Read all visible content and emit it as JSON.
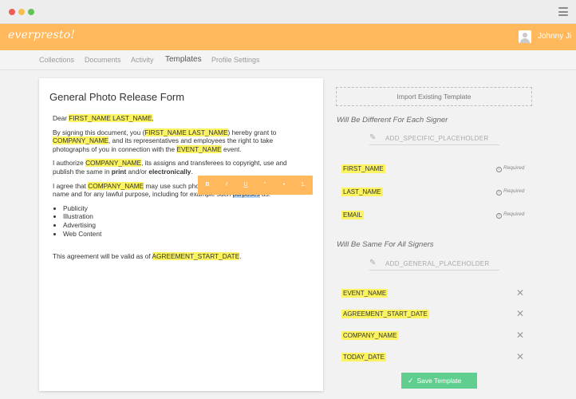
{
  "app": {
    "logo": "everpresto!",
    "user": {
      "name": "Johnny Ji"
    }
  },
  "nav": {
    "items": [
      "Collections",
      "Documents",
      "Activity",
      "Templates",
      "Profile Settings"
    ],
    "active": "Templates"
  },
  "document": {
    "title": "General Photo Release Form",
    "p1": {
      "pre": "Dear ",
      "hl": "FIRST_NAME LAST_NAME",
      "post": ","
    },
    "p2": {
      "a": "By signing this document, you (",
      "hl1": "FIRST_NAME LAST_NAME",
      "b": ") hereby grant to ",
      "hl2": "COMPANY_NAME",
      "c": ", and its representatives and employees the right to take photographs of you in connection with the ",
      "hl3": "EVENT_NAME",
      "d": " event."
    },
    "p3": {
      "a": "I authorize ",
      "hl1": "COMPANY_NAME",
      "b": ", its assigns and transferees to copyright, use and publish the same in ",
      "bold1": "print",
      "c": " and/or ",
      "bold2": "electronically",
      "d": "."
    },
    "p4": {
      "a": "I agree that ",
      "hl1": "COMPANY_NAME",
      "b": " may use such photographs of me with or without my name and for any lawful purpose, including for example such ",
      "sel": "purposes",
      "c": " as:"
    },
    "list": [
      "Publicity",
      "Illustration",
      "Advertising",
      "Web Content"
    ],
    "p5": {
      "a": "This agreement will be valid as of ",
      "hl": "AGREEMENT_START_DATE",
      "b": "."
    }
  },
  "format_toolbar": {
    "buttons": [
      "B",
      "I",
      "U",
      "\"",
      "•",
      "1."
    ]
  },
  "panel": {
    "import_label": "Import Existing Template",
    "different_heading": "Will Be Different For Each Signer",
    "specific_placeholder": "ADD_SPECIFIC_PLACEHOLDER",
    "signer_fields": [
      "FIRST_NAME",
      "LAST_NAME",
      "EMAIL"
    ],
    "required_label": "Required",
    "same_heading": "Will Be Same For All Signers",
    "general_placeholder": "ADD_GENERAL_PLACEHOLDER",
    "general_fields": [
      "EVENT_NAME",
      "AGREEMENT_START_DATE",
      "COMPANY_NAME",
      "TODAY_DATE"
    ],
    "save_label": "Save Template"
  },
  "colors": {
    "brand": "#ffb85c",
    "highlight": "#fbf35f",
    "save": "#5fce8f"
  }
}
